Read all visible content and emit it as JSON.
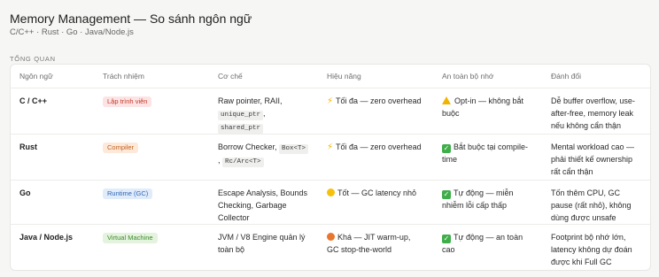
{
  "header": {
    "title": "Memory Management — So sánh ngôn ngữ",
    "subtitle": "C/C++ · Rust · Go · Java/Node.js"
  },
  "section": {
    "label": "TỔNG QUAN"
  },
  "table": {
    "columns": [
      "Ngôn ngữ",
      "Trách nhiệm",
      "Cơ chế",
      "Hiệu năng",
      "An toàn bộ nhớ",
      "Đánh đổi"
    ],
    "rows": [
      {
        "lang": "C / C++",
        "responsibility": {
          "label": "Lập trình viên",
          "bg": "#fde4e4",
          "fg": "#c0392b"
        },
        "mechanism": {
          "text": "Raw pointer, RAII,",
          "codes": [
            "unique_ptr",
            "shared_ptr"
          ]
        },
        "performance": {
          "icon": "lightning-icon",
          "text": "Tối đa — zero overhead"
        },
        "safety": {
          "icon": "warning-icon",
          "text": "Opt-in — không bắt buộc"
        },
        "tradeoff": "Dễ buffer overflow, use-after-free, memory leak nếu không cẩn thận"
      },
      {
        "lang": "Rust",
        "responsibility": {
          "label": "Compiler",
          "bg": "#fde9d9",
          "fg": "#c2611f"
        },
        "mechanism": {
          "text": "Borrow Checker,",
          "codes": [
            "Box<T>",
            "Rc/Arc<T>"
          ]
        },
        "performance": {
          "icon": "lightning-icon",
          "text": "Tối đa — zero overhead"
        },
        "safety": {
          "icon": "check-icon",
          "text": "Bắt buộc tại compile-time"
        },
        "tradeoff": "Mental workload cao — phải thiết kế ownership rất cẩn thận"
      },
      {
        "lang": "Go",
        "responsibility": {
          "label": "Runtime (GC)",
          "bg": "#e1ecfb",
          "fg": "#2f66b3"
        },
        "mechanism": {
          "text": "Escape Analysis, Bounds Checking, Garbage Collector"
        },
        "performance": {
          "icon": "yellow-circle-icon",
          "text": "Tốt — GC latency nhỏ"
        },
        "safety": {
          "icon": "check-icon",
          "text": "Tự động — miễn nhiễm lỗi cấp thấp"
        },
        "tradeoff": "Tốn thêm CPU, GC pause (rất nhỏ), không dùng được unsafe"
      },
      {
        "lang": "Java / Node.js",
        "responsibility": {
          "label": "Virtual Machine",
          "bg": "#e3f3dd",
          "fg": "#3d8a2d"
        },
        "mechanism": {
          "text": "JVM / V8 Engine quản lý toàn bộ"
        },
        "performance": {
          "icon": "orange-circle-icon",
          "text": "Khá — JIT warm-up, GC stop-the-world"
        },
        "safety": {
          "icon": "check-icon",
          "text": "Tự động — an toàn cao"
        },
        "tradeoff": "Footprint bộ nhớ lớn, latency không dự đoán được khi Full GC"
      }
    ]
  }
}
